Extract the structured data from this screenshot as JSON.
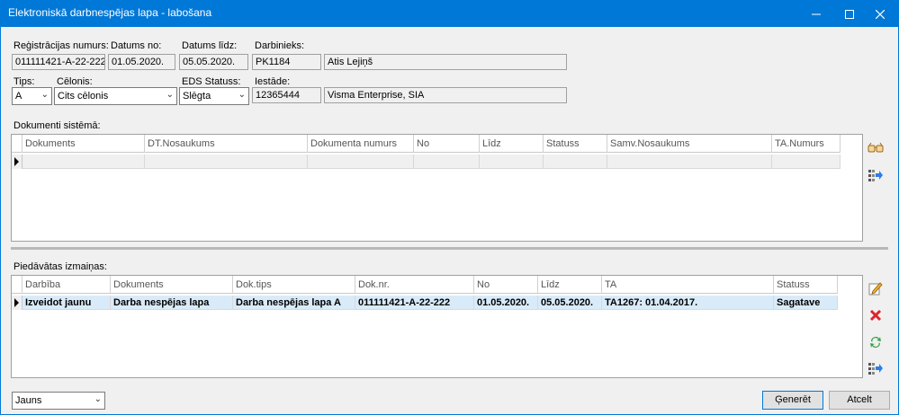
{
  "window": {
    "title": "Elektroniskā darbnespējas lapa - labošana"
  },
  "form": {
    "reg_label": "Reģistrācijas numurs:",
    "reg_value": "011111421-A-22-222",
    "from_label": "Datums no:",
    "from_value": "01.05.2020.",
    "to_label": "Datums līdz:",
    "to_value": "05.05.2020.",
    "emp_label": "Darbinieks:",
    "emp_code": "PK1184",
    "emp_name": "Atis Lejiņš",
    "type_label": "Tips:",
    "type_value": "A",
    "cause_label": "Cēlonis:",
    "cause_value": "Cits cēlonis",
    "eds_label": "EDS Statuss:",
    "eds_value": "Slēgta",
    "inst_label": "Iestāde:",
    "inst_code": "12365444",
    "inst_name": "Visma Enterprise, SIA"
  },
  "docs": {
    "label": "Dokumenti sistēmā:",
    "columns": [
      "Dokuments",
      "DT.Nosaukums",
      "Dokumenta numurs",
      "No",
      "Līdz",
      "Statuss",
      "Samv.Nosaukums",
      "TA.Numurs"
    ]
  },
  "changes": {
    "label": "Piedāvātas izmaiņas:",
    "columns": [
      "Darbība",
      "Dokuments",
      "Dok.tips",
      "Dok.nr.",
      "No",
      "Līdz",
      "TA",
      "Statuss"
    ],
    "rows": [
      [
        "Izveidot jaunu",
        "Darba nespējas lapa",
        "Darba nespējas lapa A",
        "011111421-A-22-222",
        "01.05.2020.",
        "05.05.2020.",
        "TA1267: 01.04.2017.",
        "Sagatave"
      ]
    ]
  },
  "footer": {
    "status_value": "Jauns",
    "generate_label": "Ģenerēt",
    "cancel_label": "Atcelt"
  },
  "icons": {
    "minimize": "minimize-icon",
    "maximize": "maximize-icon",
    "close": "close-icon",
    "view": "glasses-icon",
    "export": "export-icon",
    "edit": "pencil-icon",
    "delete": "delete-icon",
    "refresh": "refresh-icon"
  }
}
